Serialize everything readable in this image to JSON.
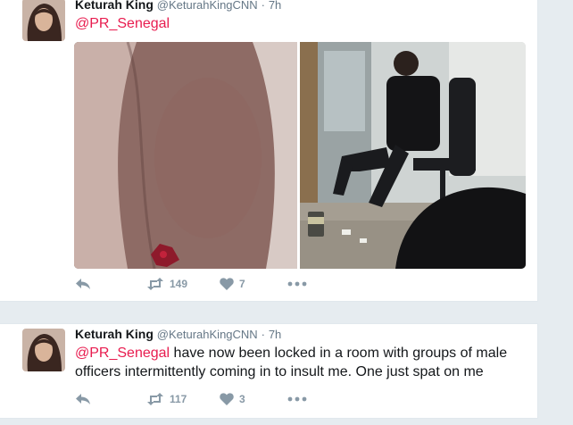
{
  "tweets": [
    {
      "author_name": "Keturah King",
      "author_handle": "@KeturahKingCNN",
      "separator": "·",
      "time": "7h",
      "mention": "@PR_Senegal",
      "body": "",
      "retweets": "149",
      "likes": "7"
    },
    {
      "author_name": "Keturah King",
      "author_handle": "@KeturahKingCNN",
      "separator": "·",
      "time": "7h",
      "mention": "@PR_Senegal",
      "body": " have now been locked in a room with groups of male officers intermittently coming in to insult me. One just spat on me",
      "retweets": "117",
      "likes": "3"
    }
  ],
  "colors": {
    "mention": "#e81c4f",
    "action_icon": "#8899a6",
    "timeline_bg": "#e6ecf0"
  },
  "icons": [
    "reply-icon",
    "retweet-icon",
    "like-icon",
    "more-icon"
  ]
}
